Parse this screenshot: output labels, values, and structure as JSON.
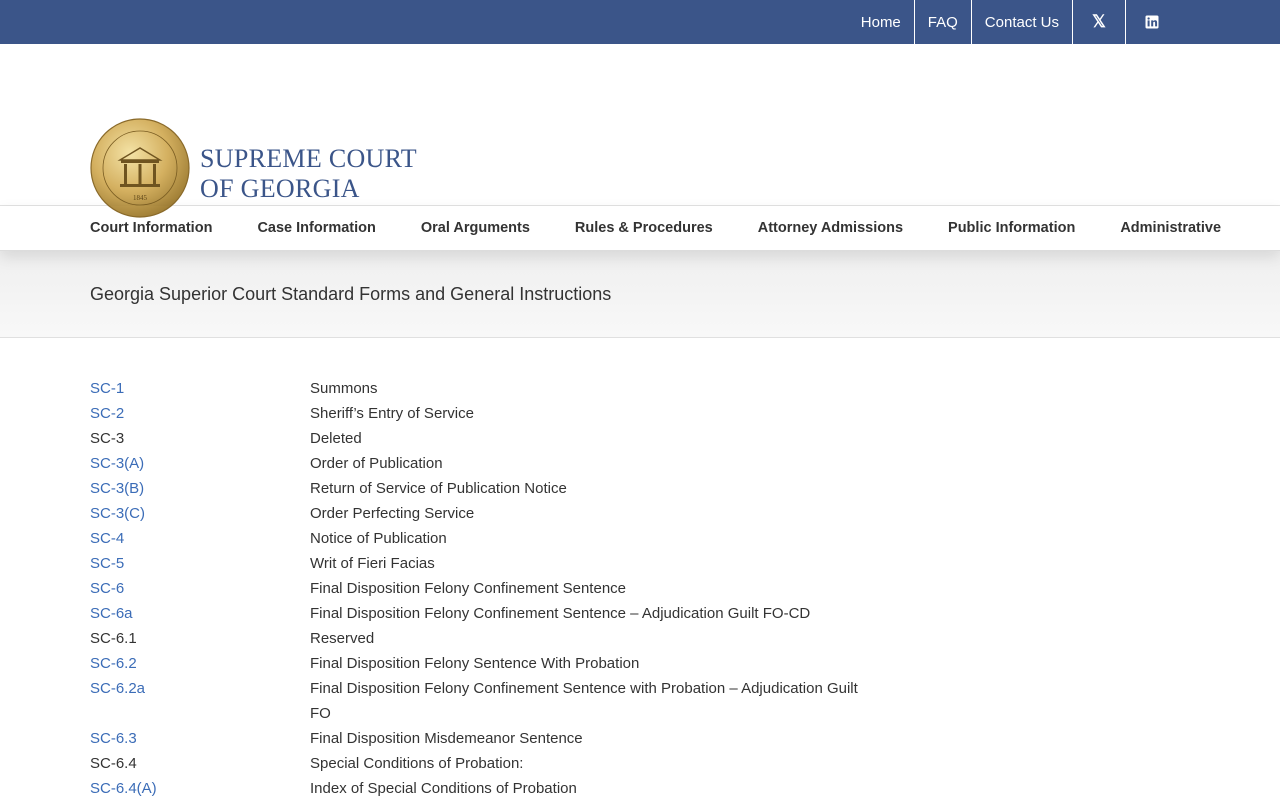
{
  "topbar": {
    "links": [
      {
        "label": "Home"
      },
      {
        "label": "FAQ"
      },
      {
        "label": "Contact Us"
      }
    ],
    "social": [
      {
        "icon": "x-twitter-icon",
        "glyph": "𝕏"
      },
      {
        "icon": "linkedin-icon",
        "glyph": "in"
      }
    ]
  },
  "header": {
    "brand_line1": "SUPREME COURT",
    "brand_line2": "OF GEORGIA",
    "seal_text": "SUPREME COURT OF GEORGIA",
    "seal_year": "1845"
  },
  "nav": {
    "items": [
      {
        "label": "Court Information"
      },
      {
        "label": "Case Information"
      },
      {
        "label": "Oral Arguments"
      },
      {
        "label": "Rules & Procedures"
      },
      {
        "label": "Attorney Admissions"
      },
      {
        "label": "Public Information"
      },
      {
        "label": "Administrative"
      }
    ]
  },
  "page": {
    "title": "Georgia Superior Court Standard Forms and General Instructions"
  },
  "forms": [
    {
      "code": "SC-1",
      "desc": "Summons",
      "link": true
    },
    {
      "code": "SC-2",
      "desc": "Sheriff’s Entry of Service",
      "link": true
    },
    {
      "code": "SC-3",
      "desc": "Deleted",
      "link": false
    },
    {
      "code": "SC-3(A)",
      "desc": "Order of Publication",
      "link": true
    },
    {
      "code": "SC-3(B)",
      "desc": "Return of Service of Publication Notice",
      "link": true
    },
    {
      "code": "SC-3(C)",
      "desc": "Order Perfecting Service",
      "link": true
    },
    {
      "code": "SC-4",
      "desc": "Notice of Publication",
      "link": true
    },
    {
      "code": "SC-5",
      "desc": "Writ of Fieri Facias",
      "link": true
    },
    {
      "code": "SC-6",
      "desc": "Final Disposition Felony Confinement Sentence",
      "link": true
    },
    {
      "code": "SC-6a",
      "desc": "Final Disposition Felony Confinement Sentence – Adjudication Guilt FO-CD",
      "link": true
    },
    {
      "code": "SC-6.1",
      "desc": "Reserved",
      "link": false
    },
    {
      "code": "SC-6.2",
      "desc": "Final Disposition Felony Sentence With Probation",
      "link": true
    },
    {
      "code": "SC-6.2a",
      "desc": "Final Disposition Felony Confinement Sentence with Probation – Adjudication Guilt FO",
      "link": true
    },
    {
      "code": "SC-6.3",
      "desc": "Final Disposition Misdemeanor Sentence",
      "link": true
    },
    {
      "code": "SC-6.4",
      "desc": "Special Conditions of Probation:",
      "link": false
    },
    {
      "code": "SC-6.4(A)",
      "desc": "Index of Special Conditions of Probation",
      "link": true
    }
  ]
}
